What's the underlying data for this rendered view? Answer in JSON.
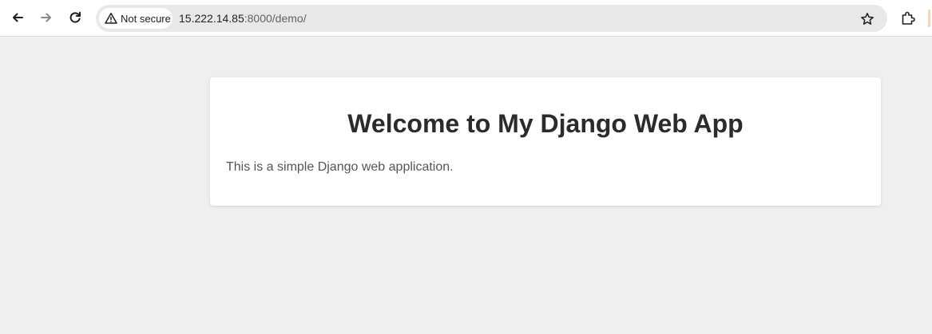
{
  "browser": {
    "security_label": "Not secure",
    "url_host": "15.222.14.85",
    "url_path": ":8000/demo/",
    "icons": [
      "back-arrow-icon",
      "forward-arrow-icon",
      "reload-icon",
      "warning-triangle-icon",
      "star-icon",
      "extensions-icon"
    ]
  },
  "page": {
    "heading": "Welcome to My Django Web App",
    "description": "This is a simple Django web application.",
    "colors": {
      "background": "#efefef",
      "card": "#ffffff",
      "heading": "#2b2b2b",
      "text": "#555555"
    }
  }
}
